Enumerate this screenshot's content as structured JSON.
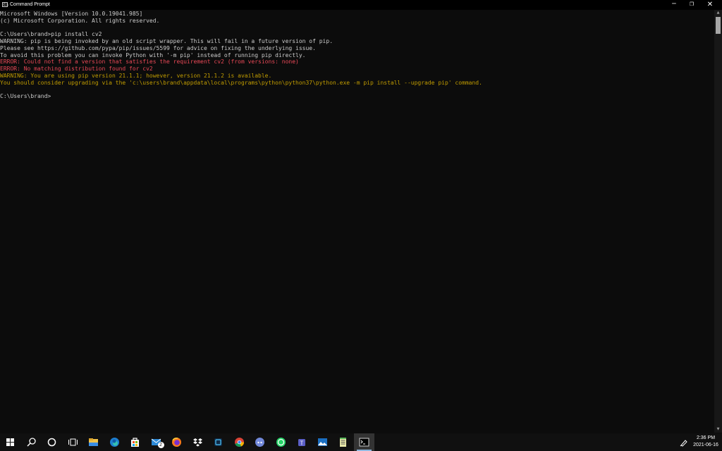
{
  "window": {
    "title": "Command Prompt",
    "icon_text": "C:\\",
    "controls": {
      "minimize": "─",
      "maximize": "❐",
      "close": "✕"
    }
  },
  "console": {
    "colors": {
      "background": "#0c0c0c",
      "default_text": "#cccccc",
      "error_text": "#e74856",
      "warning_text": "#c19c00"
    },
    "lines": [
      {
        "text": "Microsoft Windows [Version 10.0.19041.985]",
        "style": "normal"
      },
      {
        "text": "(c) Microsoft Corporation. All rights reserved.",
        "style": "normal"
      },
      {
        "text": "",
        "style": "normal"
      },
      {
        "text": "C:\\Users\\brand>pip install cv2",
        "style": "normal"
      },
      {
        "text": "WARNING: pip is being invoked by an old script wrapper. This will fail in a future version of pip.",
        "style": "normal"
      },
      {
        "text": "Please see https://github.com/pypa/pip/issues/5599 for advice on fixing the underlying issue.",
        "style": "normal"
      },
      {
        "text": "To avoid this problem you can invoke Python with '-m pip' instead of running pip directly.",
        "style": "normal"
      },
      {
        "text": "ERROR: Could not find a version that satisfies the requirement cv2 (from versions: none)",
        "style": "error"
      },
      {
        "text": "ERROR: No matching distribution found for cv2",
        "style": "error"
      },
      {
        "text": "WARNING: You are using pip version 21.1.1; however, version 21.1.2 is available.",
        "style": "warn"
      },
      {
        "text": "You should consider upgrading via the 'c:\\users\\brand\\appdata\\local\\programs\\python\\python37\\python.exe -m pip install --upgrade pip' command.",
        "style": "warn"
      },
      {
        "text": "",
        "style": "normal"
      },
      {
        "text": "C:\\Users\\brand>",
        "style": "normal"
      }
    ]
  },
  "scrollbar": {
    "up_arrow": "▲",
    "down_arrow": "▼"
  },
  "taskbar": {
    "items": [
      {
        "icon": "windows-start-icon",
        "active": false
      },
      {
        "icon": "search-icon",
        "active": false
      },
      {
        "icon": "cortana-icon",
        "active": false
      },
      {
        "icon": "task-view-icon",
        "active": false
      },
      {
        "icon": "file-explorer-icon",
        "active": false
      },
      {
        "icon": "edge-icon",
        "active": false
      },
      {
        "icon": "store-icon",
        "active": false
      },
      {
        "icon": "mail-icon",
        "active": false,
        "badge": "2"
      },
      {
        "icon": "firefox-icon",
        "active": false
      },
      {
        "icon": "dropbox-icon",
        "active": false
      },
      {
        "icon": "app-icon",
        "active": false
      },
      {
        "icon": "chrome-icon",
        "active": false
      },
      {
        "icon": "discord-icon",
        "active": false
      },
      {
        "icon": "whatsapp-icon",
        "active": false
      },
      {
        "icon": "teams-icon",
        "active": false
      },
      {
        "icon": "photos-icon",
        "active": false
      },
      {
        "icon": "notepad-icon",
        "active": false
      },
      {
        "icon": "command-prompt-icon",
        "active": true
      }
    ],
    "tray": {
      "icon": "pen-icon",
      "time": "2:36 PM",
      "date": "2021-06-16"
    }
  }
}
